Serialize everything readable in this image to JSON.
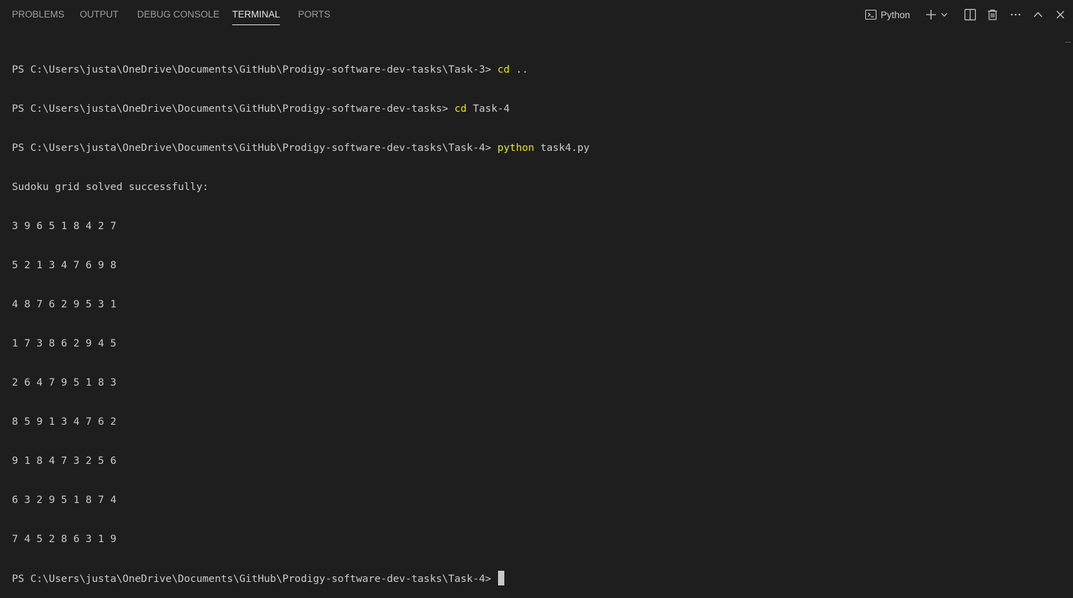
{
  "tabs": [
    {
      "label": "PROBLEMS",
      "active": false
    },
    {
      "label": "OUTPUT",
      "active": false
    },
    {
      "label": "DEBUG CONSOLE",
      "active": false
    },
    {
      "label": "TERMINAL",
      "active": true
    },
    {
      "label": "PORTS",
      "active": false
    }
  ],
  "toolbar": {
    "profile_label": "Python",
    "icons": [
      "terminal-icon",
      "plus-icon",
      "chevron-down-icon",
      "split-icon",
      "trash-icon",
      "more-icon",
      "chevron-up-icon",
      "close-icon"
    ]
  },
  "terminal": {
    "prompt1": "PS C:\\Users\\justa\\OneDrive\\Documents\\GitHub\\Prodigy-software-dev-tasks\\Task-3> ",
    "cmd1_name": "cd",
    "cmd1_args": " ..",
    "prompt2": "PS C:\\Users\\justa\\OneDrive\\Documents\\GitHub\\Prodigy-software-dev-tasks> ",
    "cmd2_name": "cd",
    "cmd2_args": " Task-4",
    "prompt3": "PS C:\\Users\\justa\\OneDrive\\Documents\\GitHub\\Prodigy-software-dev-tasks\\Task-4> ",
    "cmd3_name": "python",
    "cmd3_args": " task4.py",
    "output_header": "Sudoku grid solved successfully:",
    "grid": [
      "3 9 6 5 1 8 4 2 7",
      "5 2 1 3 4 7 6 9 8",
      "4 8 7 6 2 9 5 3 1",
      "1 7 3 8 6 2 9 4 5",
      "2 6 4 7 9 5 1 8 3",
      "8 5 9 1 3 4 7 6 2",
      "9 1 8 4 7 3 2 5 6",
      "6 3 2 9 5 1 8 7 4",
      "7 4 5 2 8 6 3 1 9"
    ],
    "prompt4": "PS C:\\Users\\justa\\OneDrive\\Documents\\GitHub\\Prodigy-software-dev-tasks\\Task-4> "
  },
  "colors": {
    "background": "#1e1e1e",
    "text": "#cccccc",
    "command": "#e5e510",
    "tab_active": "#e7e7e7",
    "tab_inactive": "#9d9d9d"
  }
}
